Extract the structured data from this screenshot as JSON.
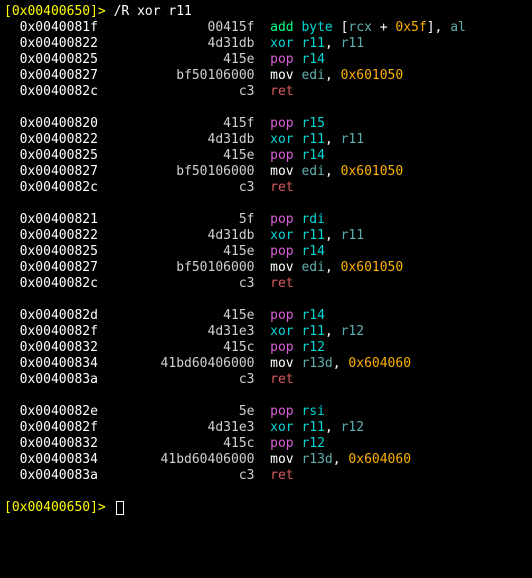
{
  "top_prompt": {
    "open": "[",
    "addr": "0x00400650",
    "close": "]> ",
    "cmd": "/R xor r11"
  },
  "groups": [
    {
      "rows": [
        {
          "addr": "0x0040081f",
          "hex": "00415f",
          "mn": "add",
          "op_parts": [
            {
              "t": "byte ",
              "c": "cyan"
            },
            {
              "t": "[",
              "c": "white"
            },
            {
              "t": "rcx",
              "c": "dimcy"
            },
            {
              "t": " + ",
              "c": "white"
            },
            {
              "t": "0x5f",
              "c": "orange"
            },
            {
              "t": "]",
              "c": "white"
            },
            {
              "t": ", ",
              "c": "white"
            },
            {
              "t": "al",
              "c": "dimcy"
            }
          ],
          "mc": "green"
        },
        {
          "addr": "0x00400822",
          "hex": "4d31db",
          "mn": "xor",
          "op_parts": [
            {
              "t": "r11",
              "c": "cyan"
            },
            {
              "t": ", ",
              "c": "white"
            },
            {
              "t": "r11",
              "c": "dimcy"
            }
          ],
          "mc": "cyan"
        },
        {
          "addr": "0x00400825",
          "hex": "415e",
          "mn": "pop",
          "op_parts": [
            {
              "t": "r14",
              "c": "cyan"
            }
          ],
          "mc": "magenta"
        },
        {
          "addr": "0x00400827",
          "hex": "bf50106000",
          "mn": "mov",
          "op_parts": [
            {
              "t": "edi",
              "c": "dimcy"
            },
            {
              "t": ", ",
              "c": "white"
            },
            {
              "t": "0x601050",
              "c": "orange"
            }
          ],
          "mc": "white"
        },
        {
          "addr": "0x0040082c",
          "hex": "c3",
          "mn": "ret",
          "op_parts": [],
          "mc": "red"
        }
      ]
    },
    {
      "rows": [
        {
          "addr": "0x00400820",
          "hex": "415f",
          "mn": "pop",
          "op_parts": [
            {
              "t": "r15",
              "c": "cyan"
            }
          ],
          "mc": "magenta"
        },
        {
          "addr": "0x00400822",
          "hex": "4d31db",
          "mn": "xor",
          "op_parts": [
            {
              "t": "r11",
              "c": "cyan"
            },
            {
              "t": ", ",
              "c": "white"
            },
            {
              "t": "r11",
              "c": "dimcy"
            }
          ],
          "mc": "cyan"
        },
        {
          "addr": "0x00400825",
          "hex": "415e",
          "mn": "pop",
          "op_parts": [
            {
              "t": "r14",
              "c": "cyan"
            }
          ],
          "mc": "magenta"
        },
        {
          "addr": "0x00400827",
          "hex": "bf50106000",
          "mn": "mov",
          "op_parts": [
            {
              "t": "edi",
              "c": "dimcy"
            },
            {
              "t": ", ",
              "c": "white"
            },
            {
              "t": "0x601050",
              "c": "orange"
            }
          ],
          "mc": "white"
        },
        {
          "addr": "0x0040082c",
          "hex": "c3",
          "mn": "ret",
          "op_parts": [],
          "mc": "red"
        }
      ]
    },
    {
      "rows": [
        {
          "addr": "0x00400821",
          "hex": "5f",
          "mn": "pop",
          "op_parts": [
            {
              "t": "rdi",
              "c": "cyan"
            }
          ],
          "mc": "magenta"
        },
        {
          "addr": "0x00400822",
          "hex": "4d31db",
          "mn": "xor",
          "op_parts": [
            {
              "t": "r11",
              "c": "cyan"
            },
            {
              "t": ", ",
              "c": "white"
            },
            {
              "t": "r11",
              "c": "dimcy"
            }
          ],
          "mc": "cyan"
        },
        {
          "addr": "0x00400825",
          "hex": "415e",
          "mn": "pop",
          "op_parts": [
            {
              "t": "r14",
              "c": "cyan"
            }
          ],
          "mc": "magenta"
        },
        {
          "addr": "0x00400827",
          "hex": "bf50106000",
          "mn": "mov",
          "op_parts": [
            {
              "t": "edi",
              "c": "dimcy"
            },
            {
              "t": ", ",
              "c": "white"
            },
            {
              "t": "0x601050",
              "c": "orange"
            }
          ],
          "mc": "white"
        },
        {
          "addr": "0x0040082c",
          "hex": "c3",
          "mn": "ret",
          "op_parts": [],
          "mc": "red"
        }
      ]
    },
    {
      "rows": [
        {
          "addr": "0x0040082d",
          "hex": "415e",
          "mn": "pop",
          "op_parts": [
            {
              "t": "r14",
              "c": "cyan"
            }
          ],
          "mc": "magenta"
        },
        {
          "addr": "0x0040082f",
          "hex": "4d31e3",
          "mn": "xor",
          "op_parts": [
            {
              "t": "r11",
              "c": "cyan"
            },
            {
              "t": ", ",
              "c": "white"
            },
            {
              "t": "r12",
              "c": "dimcy"
            }
          ],
          "mc": "cyan"
        },
        {
          "addr": "0x00400832",
          "hex": "415c",
          "mn": "pop",
          "op_parts": [
            {
              "t": "r12",
              "c": "cyan"
            }
          ],
          "mc": "magenta"
        },
        {
          "addr": "0x00400834",
          "hex": "41bd60406000",
          "mn": "mov",
          "op_parts": [
            {
              "t": "r13d",
              "c": "dimcy"
            },
            {
              "t": ", ",
              "c": "white"
            },
            {
              "t": "0x604060",
              "c": "orange"
            }
          ],
          "mc": "white"
        },
        {
          "addr": "0x0040083a",
          "hex": "c3",
          "mn": "ret",
          "op_parts": [],
          "mc": "red"
        }
      ]
    },
    {
      "rows": [
        {
          "addr": "0x0040082e",
          "hex": "5e",
          "mn": "pop",
          "op_parts": [
            {
              "t": "rsi",
              "c": "cyan"
            }
          ],
          "mc": "magenta"
        },
        {
          "addr": "0x0040082f",
          "hex": "4d31e3",
          "mn": "xor",
          "op_parts": [
            {
              "t": "r11",
              "c": "cyan"
            },
            {
              "t": ", ",
              "c": "white"
            },
            {
              "t": "r12",
              "c": "dimcy"
            }
          ],
          "mc": "cyan"
        },
        {
          "addr": "0x00400832",
          "hex": "415c",
          "mn": "pop",
          "op_parts": [
            {
              "t": "r12",
              "c": "cyan"
            }
          ],
          "mc": "magenta"
        },
        {
          "addr": "0x00400834",
          "hex": "41bd60406000",
          "mn": "mov",
          "op_parts": [
            {
              "t": "r13d",
              "c": "dimcy"
            },
            {
              "t": ", ",
              "c": "white"
            },
            {
              "t": "0x604060",
              "c": "orange"
            }
          ],
          "mc": "white"
        },
        {
          "addr": "0x0040083a",
          "hex": "c3",
          "mn": "ret",
          "op_parts": [],
          "mc": "red"
        }
      ]
    }
  ],
  "bottom_prompt": {
    "open": "[",
    "addr": "0x00400650",
    "close": "]> "
  },
  "col": {
    "addr_pad": 2,
    "hex_width": 20,
    "mn_pad": 2
  }
}
